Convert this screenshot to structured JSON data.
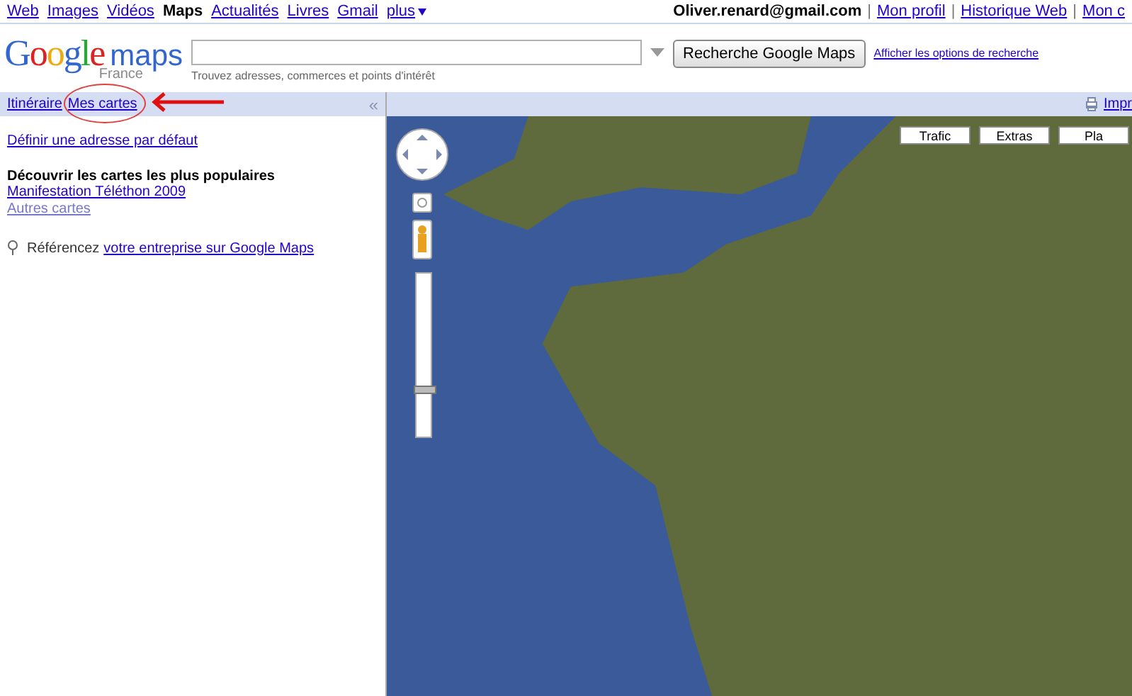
{
  "top_nav": {
    "links": [
      {
        "label": "Web",
        "selected": false
      },
      {
        "label": "Images",
        "selected": false
      },
      {
        "label": "Vidéos",
        "selected": false
      },
      {
        "label": "Maps",
        "selected": true
      },
      {
        "label": "Actualités",
        "selected": false
      },
      {
        "label": "Livres",
        "selected": false
      },
      {
        "label": "Gmail",
        "selected": false
      },
      {
        "label": "plus",
        "selected": false
      }
    ],
    "account": {
      "email": "Oliver.renard@gmail.com",
      "separator": "|",
      "links": [
        "Mon profil",
        "Historique Web",
        "Mon c"
      ]
    }
  },
  "header": {
    "logo": "Google",
    "product": "maps",
    "region": "France",
    "search_hint": "Trouvez adresses, commerces et points d'intérêt",
    "search_button": "Recherche Google Maps",
    "options_link": "Afficher les options de recherche"
  },
  "panel": {
    "tabs": [
      "Itinéraire",
      "Mes cartes"
    ],
    "collapse": "«",
    "default_address_link": "Définir une adresse par défaut",
    "popular_title": "Découvrir les cartes les plus populaires",
    "popular_links": [
      "Manifestation Téléthon 2009",
      "Autres cartes"
    ],
    "business_text": "Référencez",
    "business_link": "votre entreprise sur Google Maps"
  },
  "map": {
    "print_link": "Impr",
    "buttons": [
      "Trafic",
      "Extras",
      "Pla"
    ],
    "zoom": {
      "level": 0.31
    }
  }
}
